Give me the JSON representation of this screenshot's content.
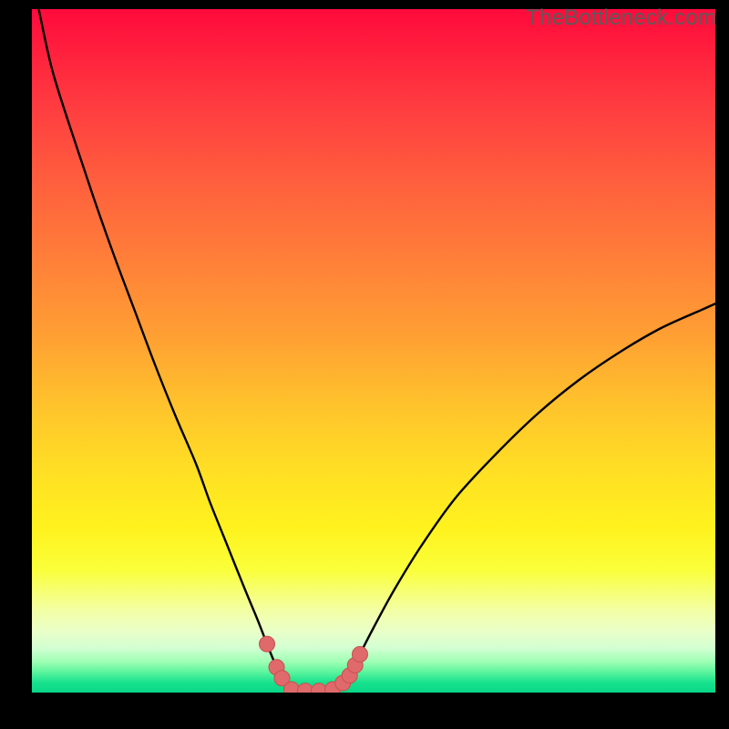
{
  "watermark": "TheBottleneck.com",
  "colors": {
    "curve": "#000000",
    "marker_fill": "#e06a6b",
    "marker_stroke": "#c84f50",
    "gradient_top": "#ff0a3c",
    "gradient_bottom": "#08d687",
    "frame_bg": "#000000"
  },
  "chart_data": {
    "type": "line",
    "title": "",
    "xlabel": "",
    "ylabel": "",
    "xlim": [
      0,
      100
    ],
    "ylim": [
      0,
      100
    ],
    "grid": false,
    "legend": false,
    "note": "Bottleneck-style V-curve. x is a normalized component-ratio axis (0-100), y is bottleneck percentage (0 at the green bottom, 100 at the red top). Values are estimated from pixel positions; the source page did not label axes or ticks.",
    "series": [
      {
        "name": "bottleneck-curve",
        "x": [
          1,
          3,
          6,
          9,
          12,
          15,
          18,
          21,
          24,
          26,
          28,
          30,
          31.5,
          33,
          34.4,
          35,
          35.8,
          36.6,
          38,
          40,
          42,
          44,
          45.5,
          46.5,
          47.3,
          48,
          50,
          53,
          57,
          62,
          68,
          74,
          80,
          86,
          92,
          98,
          100
        ],
        "y": [
          100,
          91,
          81.5,
          72.5,
          64,
          56,
          48,
          40.5,
          33.5,
          28,
          23,
          18,
          14.3,
          10.7,
          7.1,
          5.6,
          3.7,
          2.1,
          0.45,
          0.23,
          0.23,
          0.45,
          1.4,
          2.5,
          4,
          5.6,
          9.5,
          15,
          21.5,
          28.5,
          35,
          40.8,
          45.7,
          49.8,
          53.3,
          56,
          56.9
        ]
      }
    ],
    "markers": {
      "name": "highlight-points",
      "x": [
        34.4,
        35.8,
        36.6,
        38,
        40,
        42,
        44,
        45.5,
        46.5,
        47.3,
        48
      ],
      "y": [
        7.1,
        3.7,
        2.1,
        0.45,
        0.23,
        0.23,
        0.45,
        1.4,
        2.5,
        4.0,
        5.6
      ]
    }
  }
}
